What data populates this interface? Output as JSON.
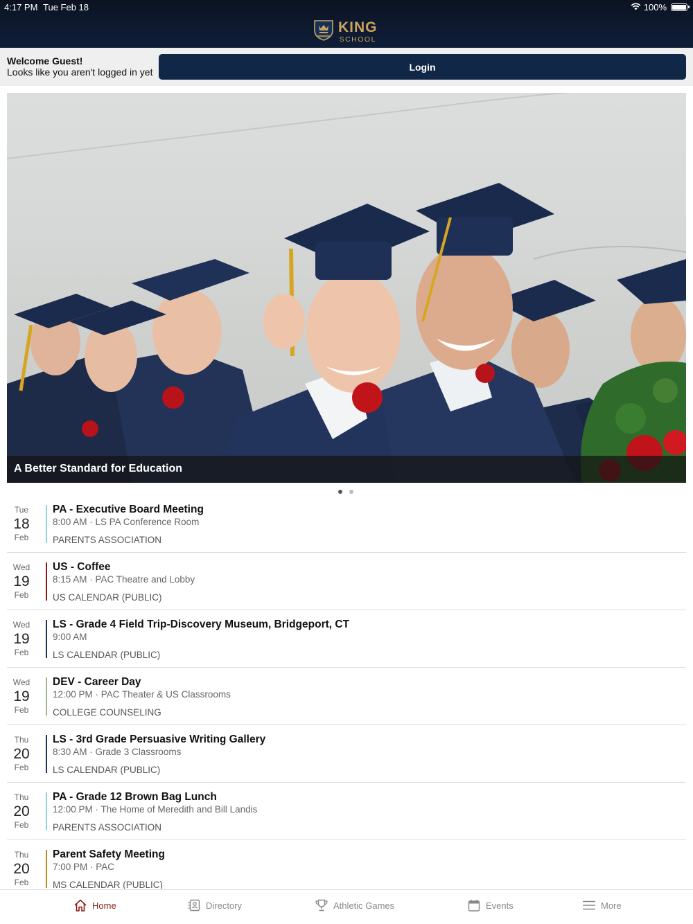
{
  "status": {
    "time": "4:17 PM",
    "date": "Tue Feb 18",
    "battery": "100%",
    "battery_level": 1.0,
    "wifi_icon": "wifi-icon"
  },
  "header": {
    "logo_title": "KING",
    "logo_subtitle": "SCHOOL",
    "logo_icon": "crest-icon",
    "brand_color": "#c9a45c"
  },
  "guest": {
    "welcome": "Welcome Guest!",
    "message": "Looks like you aren't logged in yet",
    "login_label": "Login",
    "button_color": "#102747"
  },
  "hero": {
    "caption": "A Better Standard for Education",
    "slides": 2,
    "active_slide": 1
  },
  "events": [
    {
      "dow": "Tue",
      "day": "18",
      "month": "Feb",
      "title": "PA - Executive Board Meeting",
      "details": "8:00 AM · LS PA Conference Room",
      "calendar": "PARENTS ASSOCIATION",
      "color": "#8fd3de"
    },
    {
      "dow": "Wed",
      "day": "19",
      "month": "Feb",
      "title": "US - Coffee",
      "details": "8:15 AM · PAC Theatre and Lobby",
      "calendar": "US CALENDAR (PUBLIC)",
      "color": "#8c1c13"
    },
    {
      "dow": "Wed",
      "day": "19",
      "month": "Feb",
      "title": "LS - Grade 4 Field Trip-Discovery Museum, Bridgeport, CT",
      "details": "9:00 AM",
      "calendar": "LS CALENDAR (PUBLIC)",
      "color": "#1f3357"
    },
    {
      "dow": "Wed",
      "day": "19",
      "month": "Feb",
      "title": "DEV - Career Day",
      "details": "12:00 PM · PAC Theater & US Classrooms",
      "calendar": "COLLEGE COUNSELING",
      "color": "#9fb48c"
    },
    {
      "dow": "Thu",
      "day": "20",
      "month": "Feb",
      "title": "LS - 3rd Grade Persuasive Writing Gallery",
      "details": "8:30 AM · Grade 3 Classrooms",
      "calendar": "LS CALENDAR (PUBLIC)",
      "color": "#1f3357"
    },
    {
      "dow": "Thu",
      "day": "20",
      "month": "Feb",
      "title": "PA - Grade 12 Brown Bag Lunch",
      "details": "12:00 PM · The Home of Meredith and Bill Landis",
      "calendar": "PARENTS ASSOCIATION",
      "color": "#8fd3de"
    },
    {
      "dow": "Thu",
      "day": "20",
      "month": "Feb",
      "title": "Parent Safety Meeting",
      "details": "7:00 PM · PAC",
      "calendar": "MS CALENDAR (PUBLIC)",
      "color": "#c48a1e"
    }
  ],
  "tabs": [
    {
      "label": "Home",
      "icon": "home-icon",
      "active": true
    },
    {
      "label": "Directory",
      "icon": "directory-icon",
      "active": false
    },
    {
      "label": "Athletic Games",
      "icon": "trophy-icon",
      "active": false
    },
    {
      "label": "Events",
      "icon": "calendar-icon",
      "active": false
    },
    {
      "label": "More",
      "icon": "menu-icon",
      "active": false
    }
  ],
  "colors": {
    "active_tab": "#8c1c13",
    "inactive_tab": "#888888"
  }
}
